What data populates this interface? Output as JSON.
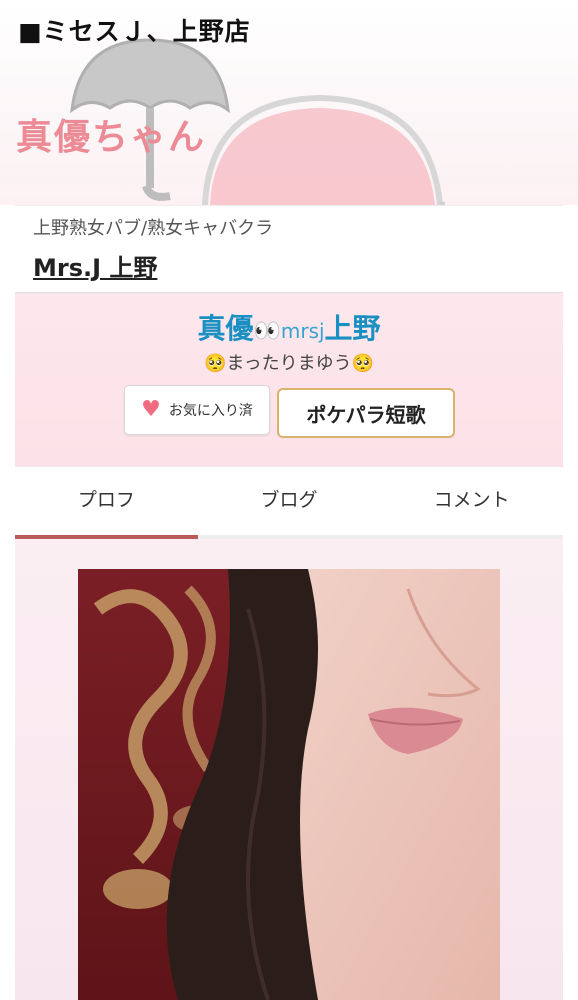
{
  "header": {
    "shop_title": "■ミセスＪ、上野店",
    "cast_name": "真優ちゃん"
  },
  "shop": {
    "genre": "上野熟女パブ/熟女キャバクラ",
    "name": "Mrs.J 上野"
  },
  "profile": {
    "name_main": "真優",
    "name_eyes": "👀",
    "name_sub": "mrsj",
    "name_end": "上野",
    "catchphrase": "🥺まったりまゆう🥺"
  },
  "buttons": {
    "favorite_label": "お気に入り済",
    "tanka_label": "ポケパラ短歌"
  },
  "tabs": [
    {
      "label": "プロフ",
      "active": true
    },
    {
      "label": "ブログ",
      "active": false
    },
    {
      "label": "コメント",
      "active": false
    }
  ],
  "colors": {
    "cast_name": "#ec8a96",
    "profile_name": "#1a8fc2",
    "active_tab": "#b75b5b",
    "tanka_border": "#d9b26d",
    "heart": "#f06a80"
  }
}
